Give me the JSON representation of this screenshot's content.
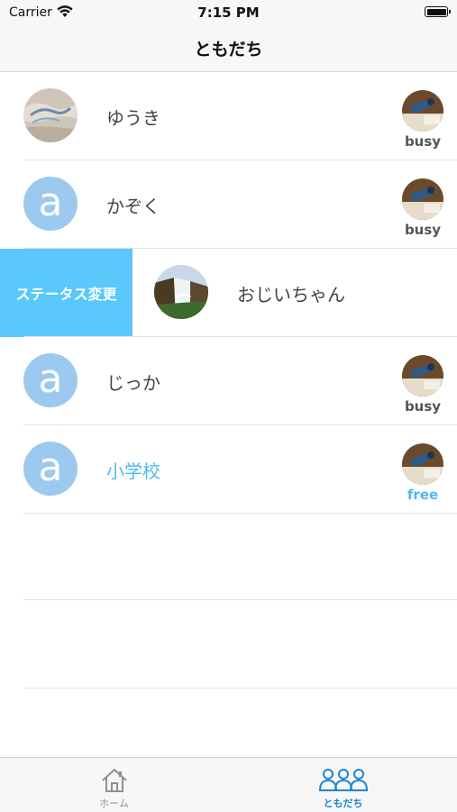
{
  "status_bar": {
    "carrier": "Carrier",
    "time": "7:15 PM"
  },
  "nav": {
    "title": "ともだち"
  },
  "friends": [
    {
      "name": "ゆうき",
      "avatar": "photo-icon",
      "status": "busy"
    },
    {
      "name": "かぞく",
      "avatar": "a",
      "status": "busy"
    },
    {
      "name": "じっか",
      "avatar": "a",
      "status": "busy"
    },
    {
      "name": "小学校",
      "avatar": "a",
      "status": "free"
    }
  ],
  "swiped_row": {
    "action_label": "ステータス変更",
    "name": "おじいちゃん",
    "avatar": "waterfall-photo-icon"
  },
  "tabs": [
    {
      "label": "ホーム",
      "icon": "home-icon",
      "selected": false
    },
    {
      "label": "ともだち",
      "icon": "friends-icon",
      "selected": true
    }
  ],
  "colors": {
    "accent": "#5ac8fa",
    "free": "#4fb8f0",
    "avatar_bg": "#9cc9ef",
    "tab_selected": "#1a86d6"
  }
}
